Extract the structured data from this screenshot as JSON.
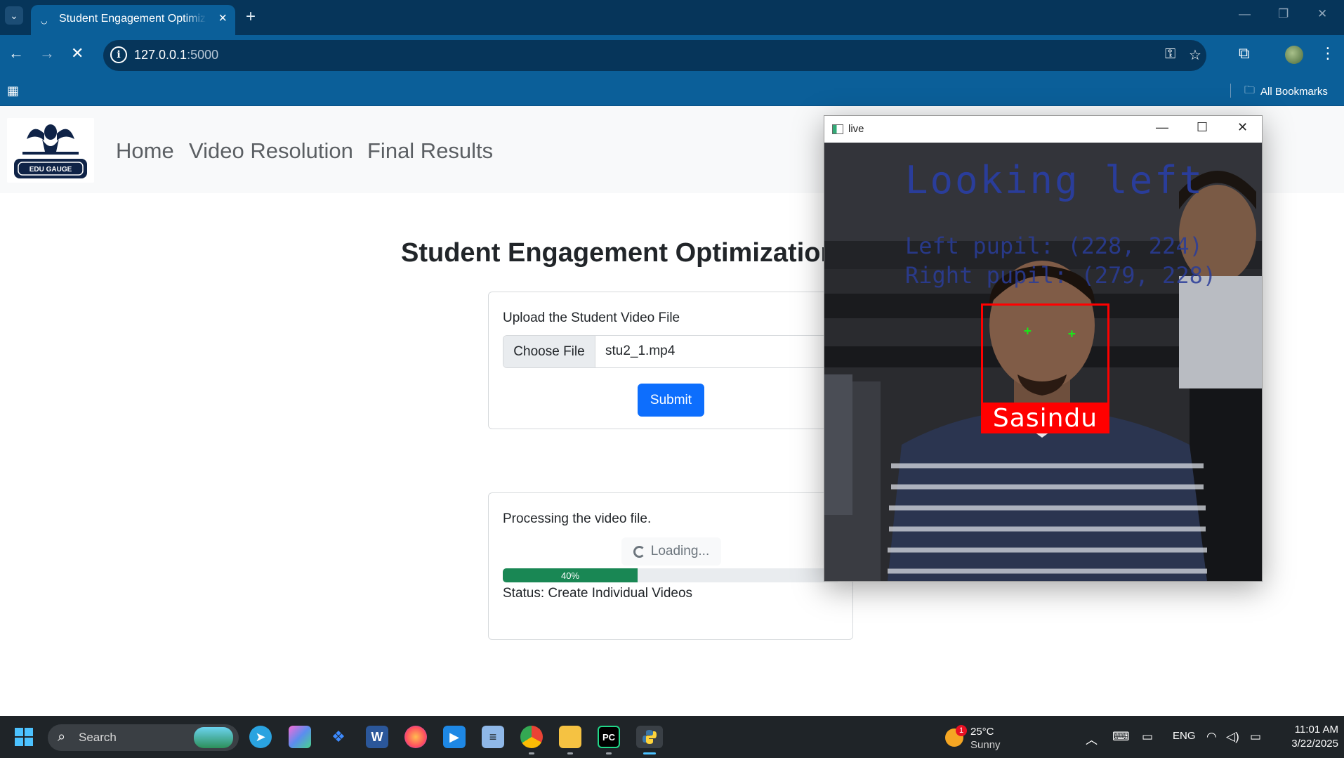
{
  "browser": {
    "tab_title": "Student Engagement Optimization",
    "url_host": "127.0.0.1",
    "url_port": ":5000",
    "bookmarks_label": "All Bookmarks"
  },
  "site": {
    "logo_text": "EDU GAUGE",
    "nav": [
      "Home",
      "Video Resolution",
      "Final Results"
    ],
    "heading": "Student Engagement Optimization",
    "upload_label": "Upload the Student Video File",
    "choose_file_label": "Choose File",
    "file_name": "stu2_1.mp4",
    "submit_label": "Submit",
    "processing_text": "Processing the video file.",
    "loading_text": "Loading...",
    "progress_percent": 40,
    "progress_label": "40%",
    "status_text": "Status: Create Individual Videos"
  },
  "live_window": {
    "title": "live",
    "gaze_text": "Looking left",
    "left_pupil_text": "Left pupil: (228, 224)",
    "right_pupil_text": "Right pupil: (279, 228)",
    "person_name": "Sasindu",
    "pupil_marker": "+"
  },
  "taskbar": {
    "search_label": "Search",
    "weather_badge": "1",
    "weather_temp": "25°C",
    "weather_cond": "Sunny",
    "language": "ENG",
    "time": "11:01 AM",
    "date": "3/22/2025"
  },
  "colors": {
    "tabbar": "#06355a",
    "toolbar": "#0b5f99",
    "primary": "#0d6efd",
    "success": "#198754",
    "face_box": "#ff0000",
    "cv_text": "#2a3d9a"
  }
}
